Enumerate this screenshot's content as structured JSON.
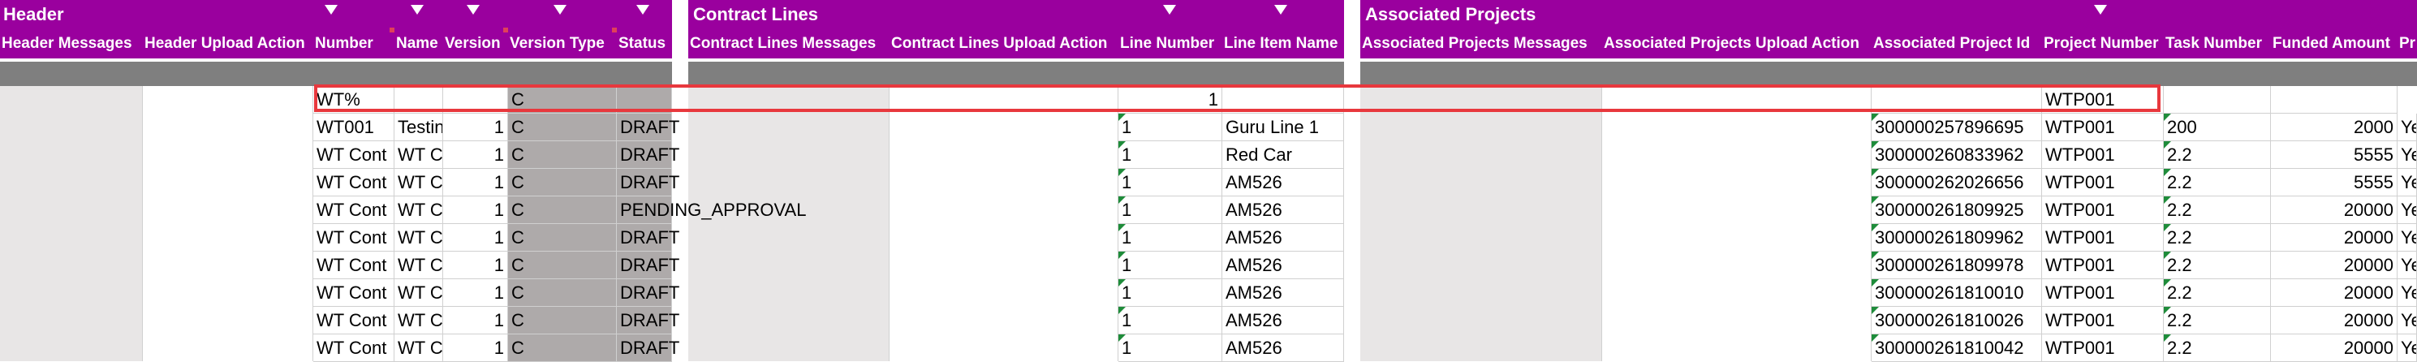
{
  "sections": {
    "header": "Header",
    "contract_lines": "Contract Lines",
    "associated_projects": "Associated Projects"
  },
  "columns": {
    "header_messages": "Header Messages",
    "header_upload_action": "Header Upload Action",
    "number": "Number",
    "name": "Name",
    "version": "Version",
    "version_type": "Version Type",
    "status": "Status",
    "contract_lines_messages": "Contract Lines Messages",
    "contract_lines_upload_action": "Contract Lines Upload Action",
    "line_number": "Line Number",
    "line_item_name": "Line Item Name",
    "associated_projects_messages": "Associated Projects Messages",
    "associated_projects_upload_action": "Associated Projects Upload Action",
    "associated_project_id": "Associated Project Id",
    "project_number": "Project Number",
    "task_number": "Task Number",
    "funded_amount": "Funded Amount",
    "last_partial": "Pr"
  },
  "filter_row": {
    "number": "WT%",
    "version_type": "C",
    "line_number": "1",
    "project_number": "WTP001"
  },
  "rows": [
    {
      "number": "WT001",
      "name": "Testin",
      "version": "1",
      "version_type": "C",
      "status": "DRAFT",
      "line_number": "1",
      "line_item_name": "Guru Line 1",
      "project_id": "300000257896695",
      "project_number": "WTP001",
      "task_number": "200",
      "funded_amount": "2000",
      "extra": "Ye"
    },
    {
      "number": "WT Cont",
      "name": "WT C",
      "version": "1",
      "version_type": "C",
      "status": "DRAFT",
      "line_number": "1",
      "line_item_name": "Red Car",
      "project_id": "300000260833962",
      "project_number": "WTP001",
      "task_number": "2.2",
      "funded_amount": "5555",
      "extra": "Ye"
    },
    {
      "number": "WT Cont",
      "name": "WT C",
      "version": "1",
      "version_type": "C",
      "status": "DRAFT",
      "line_number": "1",
      "line_item_name": "AM526",
      "project_id": "300000262026656",
      "project_number": "WTP001",
      "task_number": "2.2",
      "funded_amount": "5555",
      "extra": "Ye"
    },
    {
      "number": "WT Cont",
      "name": "WT C",
      "version": "1",
      "version_type": "C",
      "status": "PENDING_APPROVAL",
      "line_number": "1",
      "line_item_name": "AM526",
      "project_id": "300000261809925",
      "project_number": "WTP001",
      "task_number": "2.2",
      "funded_amount": "20000",
      "extra": "Ye"
    },
    {
      "number": "WT Cont",
      "name": "WT C",
      "version": "1",
      "version_type": "C",
      "status": "DRAFT",
      "line_number": "1",
      "line_item_name": "AM526",
      "project_id": "300000261809962",
      "project_number": "WTP001",
      "task_number": "2.2",
      "funded_amount": "20000",
      "extra": "Ye"
    },
    {
      "number": "WT Cont",
      "name": "WT C",
      "version": "1",
      "version_type": "C",
      "status": "DRAFT",
      "line_number": "1",
      "line_item_name": "AM526",
      "project_id": "300000261809978",
      "project_number": "WTP001",
      "task_number": "2.2",
      "funded_amount": "20000",
      "extra": "Ye"
    },
    {
      "number": "WT Cont",
      "name": "WT C",
      "version": "1",
      "version_type": "C",
      "status": "DRAFT",
      "line_number": "1",
      "line_item_name": "AM526",
      "project_id": "300000261810010",
      "project_number": "WTP001",
      "task_number": "2.2",
      "funded_amount": "20000",
      "extra": "Ye"
    },
    {
      "number": "WT Cont",
      "name": "WT C",
      "version": "1",
      "version_type": "C",
      "status": "DRAFT",
      "line_number": "1",
      "line_item_name": "AM526",
      "project_id": "300000261810026",
      "project_number": "WTP001",
      "task_number": "2.2",
      "funded_amount": "20000",
      "extra": "Ye"
    },
    {
      "number": "WT Cont",
      "name": "WT C",
      "version": "1",
      "version_type": "C",
      "status": "DRAFT",
      "line_number": "1",
      "line_item_name": "AM526",
      "project_id": "300000261810042",
      "project_number": "WTP001",
      "task_number": "2.2",
      "funded_amount": "20000",
      "extra": "Ye"
    }
  ],
  "icons": {
    "filter": "filter-dropdown-icon",
    "required": "required-marker-icon",
    "note": "cell-comment-indicator-icon"
  },
  "colors": {
    "header_band": "#9a009e",
    "gray_bar": "#7f7f7f",
    "selection": "#e8383d",
    "comment_indicator": "#1e8c3a"
  }
}
